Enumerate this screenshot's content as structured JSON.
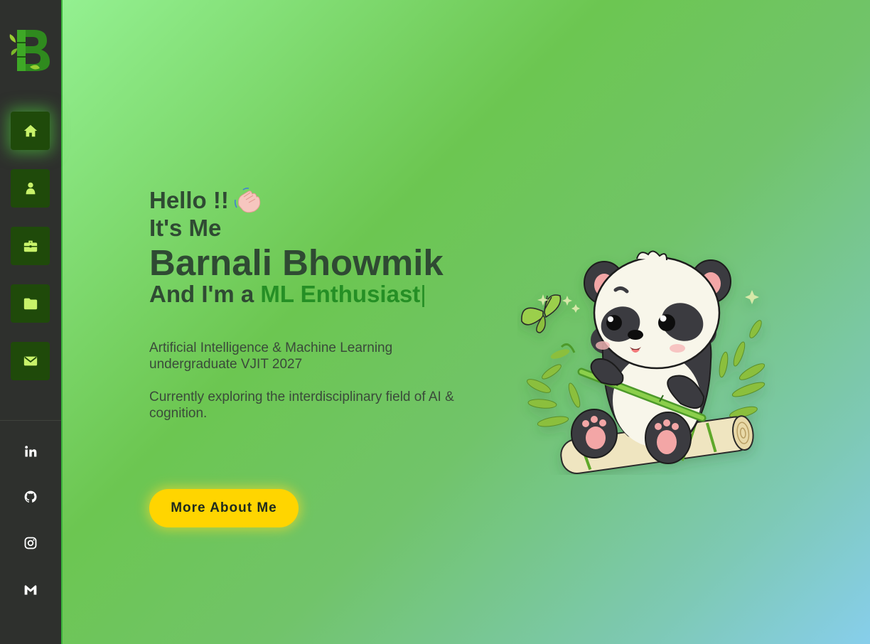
{
  "brand": {
    "logo_letter": "B",
    "logo_alt": "bamboo-b-logo"
  },
  "sidebar": {
    "nav": [
      {
        "id": "home",
        "icon": "home-icon",
        "active": true
      },
      {
        "id": "about",
        "icon": "user-icon",
        "active": false
      },
      {
        "id": "experience",
        "icon": "briefcase-icon",
        "active": false
      },
      {
        "id": "projects",
        "icon": "folder-icon",
        "active": false
      },
      {
        "id": "contact",
        "icon": "mail-icon",
        "active": false
      }
    ],
    "socials": [
      {
        "id": "linkedin",
        "icon": "linkedin-icon"
      },
      {
        "id": "github",
        "icon": "github-icon"
      },
      {
        "id": "instagram",
        "icon": "instagram-icon"
      },
      {
        "id": "gmail",
        "icon": "gmail-icon"
      }
    ]
  },
  "hero": {
    "greeting": "Hello !!",
    "intro": "It's Me",
    "name": "Barnali Bhowmik",
    "role_prefix": "And I'm a ",
    "role": "ML Enthusiast",
    "cursor": "|",
    "description_1": "Artificial Intelligence & Machine Learning undergraduate VJIT 2027",
    "description_2": "Currently exploring the interdisciplinary field of AI & cognition.",
    "cta_label": "More About Me"
  },
  "colors": {
    "sidebar_bg": "#2e302d",
    "nav_bg": "#1f4a0a",
    "nav_icon": "#c8f26a",
    "role_green": "#258f25",
    "cta_yellow": "#ffd500",
    "text_dark": "#2f4a33"
  }
}
